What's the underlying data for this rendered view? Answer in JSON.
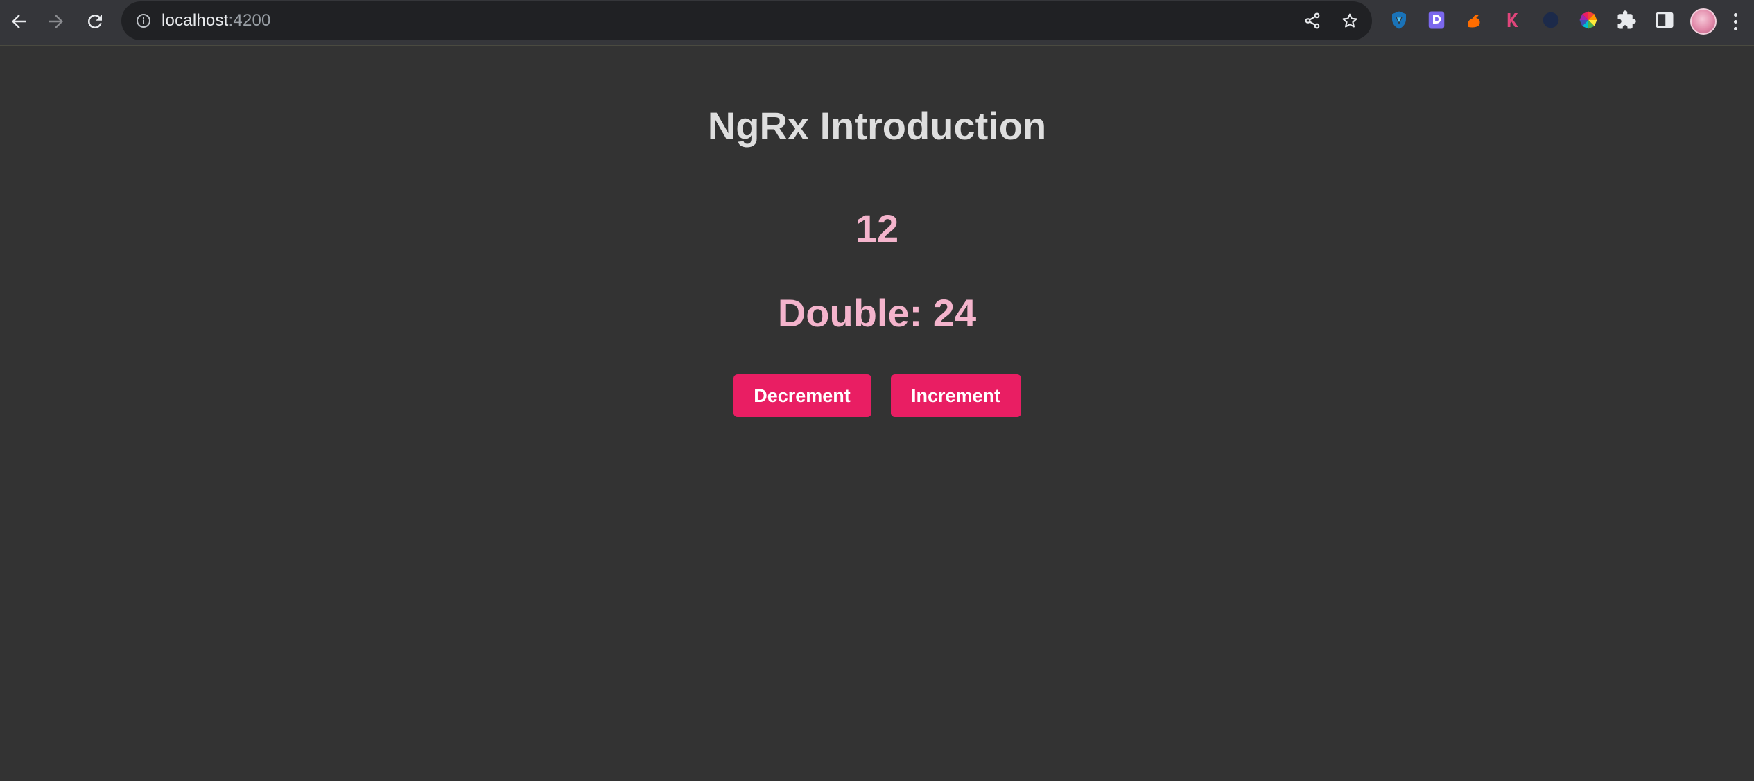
{
  "browser": {
    "url_host": "localhost",
    "url_port": ":4200",
    "icons": {
      "back": "back-arrow-icon",
      "forward": "forward-arrow-icon",
      "reload": "reload-icon",
      "info": "info-icon",
      "share": "share-icon",
      "bookmark": "star-icon",
      "extensions": [
        "shield-extension-icon",
        "d-extension-icon",
        "squirrel-extension-icon",
        "k-extension-icon",
        "moon-extension-icon",
        "color-wheel-extension-icon",
        "puzzle-icon",
        "side-panel-icon"
      ]
    }
  },
  "page": {
    "title": "NgRx Introduction",
    "count": "12",
    "double_text": "Double: 24",
    "buttons": {
      "decrement": "Decrement",
      "increment": "Increment"
    }
  },
  "colors": {
    "background": "#333333",
    "accent": "#e91e63",
    "value_text": "#f4b4cc",
    "title_text": "#dedede"
  }
}
